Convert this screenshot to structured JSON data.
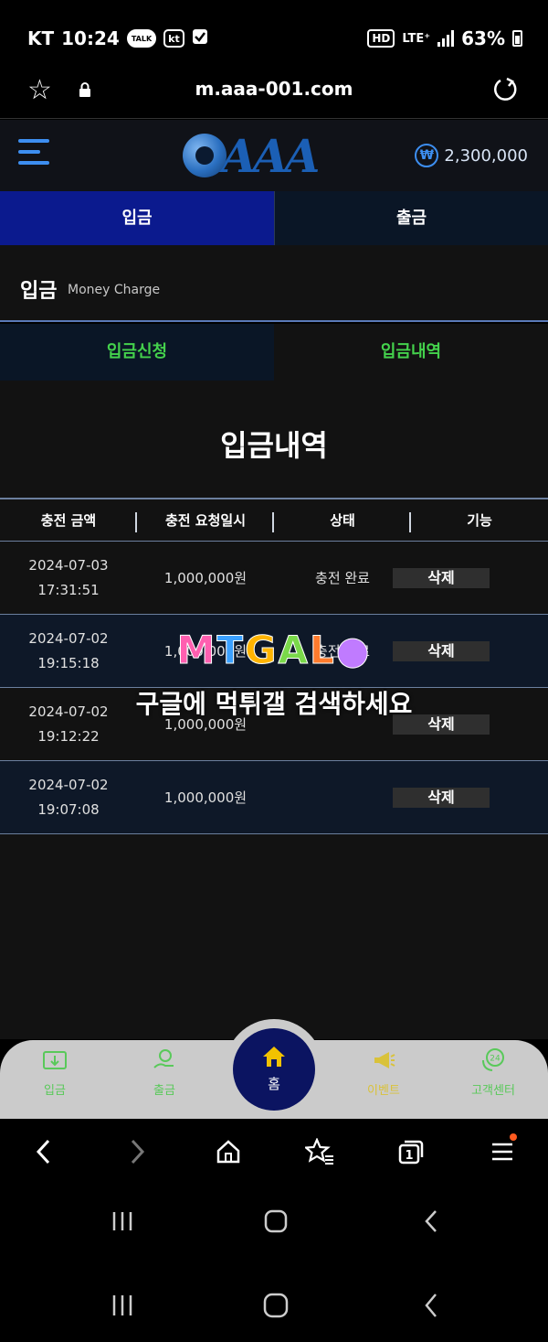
{
  "status_bar": {
    "carrier": "KT",
    "time": "10:24",
    "notif_talk": "TALK",
    "notif_kt": "kt",
    "hd": "HD",
    "network": "LTE⁺",
    "battery": "63%"
  },
  "url_bar": {
    "url": "m.aaa-001.com"
  },
  "header": {
    "logo_text": "AAA",
    "currency_symbol": "₩",
    "balance": "2,300,000"
  },
  "top_tabs": [
    {
      "label": "입금",
      "active": true
    },
    {
      "label": "출금",
      "active": false
    }
  ],
  "page": {
    "title": "입금",
    "subtitle": "Money Charge"
  },
  "sub_tabs": [
    {
      "label": "입금신청",
      "active": false
    },
    {
      "label": "입금내역",
      "active": true
    }
  ],
  "section_title": "입금내역",
  "table": {
    "headers": [
      "충전 금액",
      "충전 요청일시",
      "상태",
      "기능"
    ],
    "rows": [
      {
        "date": "2024-07-03",
        "time": "17:31:51",
        "amount": "1,000,000원",
        "status": "충전 완료",
        "action": "삭제"
      },
      {
        "date": "2024-07-02",
        "time": "19:15:18",
        "amount": "1,000,000원",
        "status": "충전 완료",
        "action": "삭제"
      },
      {
        "date": "2024-07-02",
        "time": "19:12:22",
        "amount": "1,000,000원",
        "status": "",
        "action": "삭제"
      },
      {
        "date": "2024-07-02",
        "time": "19:07:08",
        "amount": "1,000,000원",
        "status": "",
        "action": "삭제"
      }
    ]
  },
  "watermark": {
    "logo": [
      "M",
      "T",
      "G",
      "A",
      "L",
      "●"
    ],
    "text": "구글에 먹튀갤 검색하세요"
  },
  "bottom_nav": {
    "deposit": "입금",
    "withdraw": "출금",
    "home": "홈",
    "event": "이벤트",
    "support": "고객센터",
    "support_badge": "24"
  },
  "colors": {
    "active_tab": "#0b1a8e",
    "accent_green": "#44d24c",
    "accent_blue": "#3d8ef0",
    "home_button": "#0b1461"
  }
}
